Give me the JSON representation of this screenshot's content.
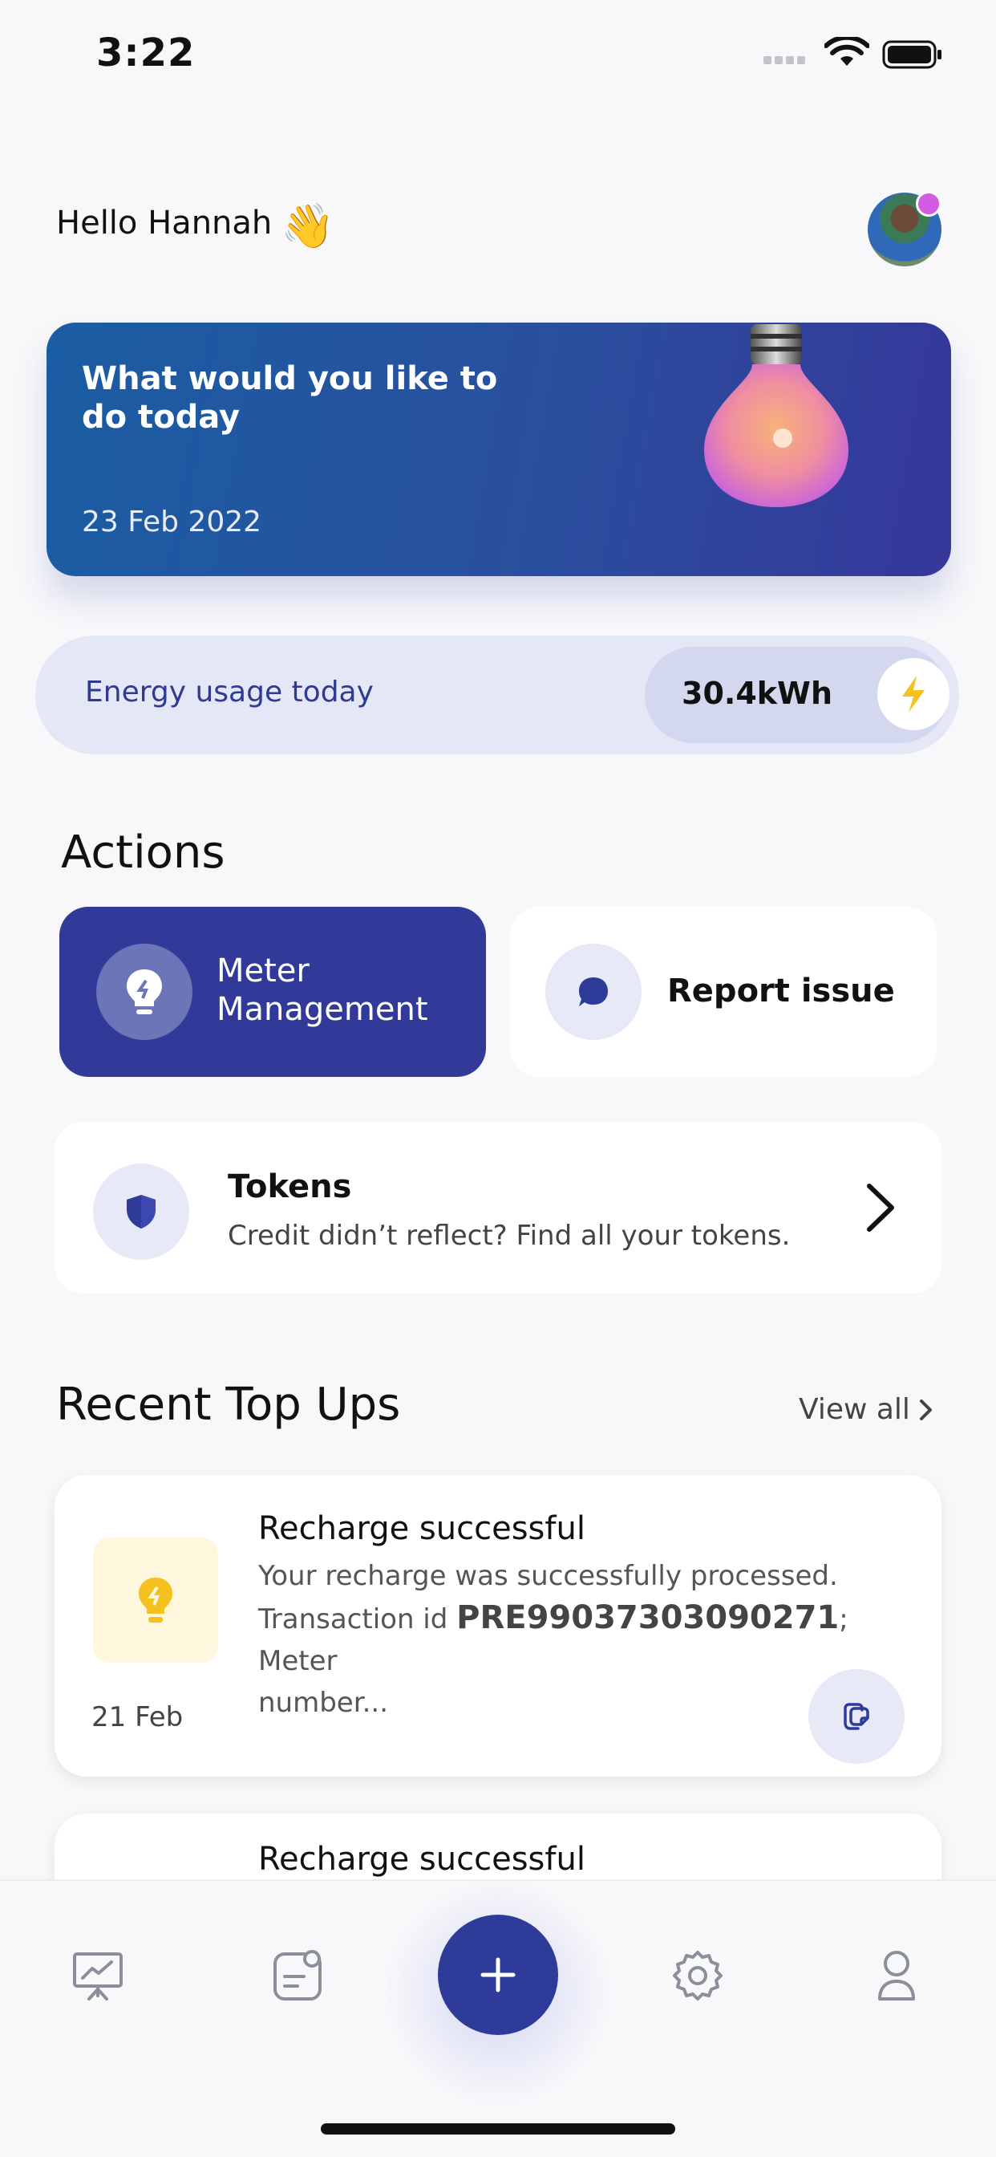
{
  "status_bar": {
    "time": "3:22"
  },
  "greeting": {
    "text": "Hello Hannah",
    "emoji": "👋"
  },
  "hero": {
    "title": "What would you like to do today",
    "date": "23 Feb 2022"
  },
  "energy": {
    "label": "Energy usage today",
    "value": "30.4kWh"
  },
  "actions": {
    "title": "Actions",
    "meter_label": "Meter Management",
    "report_label": "Report issue"
  },
  "tokens": {
    "title": "Tokens",
    "subtitle": "Credit didn’t reflect? Find all your tokens."
  },
  "recent": {
    "title": "Recent Top Ups",
    "view_all": "View all",
    "items": [
      {
        "title": "Recharge successful",
        "line1": "Your recharge was successfully processed.",
        "line2_prefix": "Transaction id ",
        "transaction_id": "PRE99037303090271",
        "line2_suffix": "; Meter",
        "line3": "number...",
        "date": "21 Feb"
      },
      {
        "title": "Recharge successful"
      }
    ]
  },
  "tabs": [
    "dashboard-icon",
    "transactions-icon",
    "add-icon",
    "settings-icon",
    "profile-icon"
  ],
  "colors": {
    "primary": "#2f3b99",
    "hero_start": "#1a5da3",
    "hero_end": "#36379a",
    "accent_yellow": "#f4c21e"
  }
}
